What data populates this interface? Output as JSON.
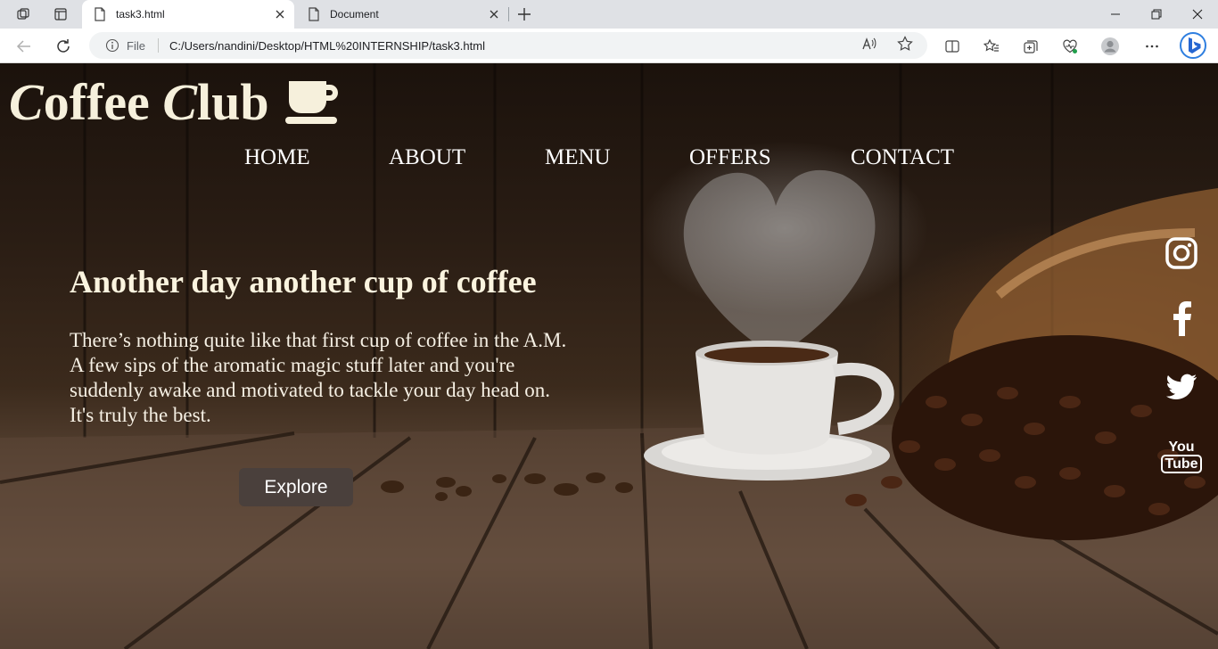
{
  "browser": {
    "tabs": [
      {
        "title": "task3.html",
        "active": true
      },
      {
        "title": "Document",
        "active": false
      }
    ],
    "address": {
      "file_label": "File",
      "url": "C:/Users/nandini/Desktop/HTML%20INTERNSHIP/task3.html"
    }
  },
  "site": {
    "brand": {
      "c1": "C",
      "r1": "offee ",
      "c2": "C",
      "r2": "lub"
    },
    "nav": [
      "HOME",
      "ABOUT",
      "MENU",
      "OFFERS",
      "CONTACT"
    ],
    "hero": {
      "title": "Another day another cup of coffee",
      "line1": "There’s nothing quite like that first cup of coffee in the A.M.",
      "line2": "A few sips of the aromatic magic stuff later and you're",
      "line3": "suddenly awake and motivated to tackle your day head on.",
      "line4": "It's truly the best.",
      "button": "Explore"
    },
    "social": [
      "instagram-icon",
      "facebook-icon",
      "twitter-icon",
      "youtube-icon"
    ],
    "youtube_text": {
      "top": "You",
      "bottom": "Tube"
    }
  },
  "colors": {
    "brand_text": "#f6f0dc",
    "button_bg": "#4a403c",
    "tab_bar": "#dfe1e5"
  }
}
